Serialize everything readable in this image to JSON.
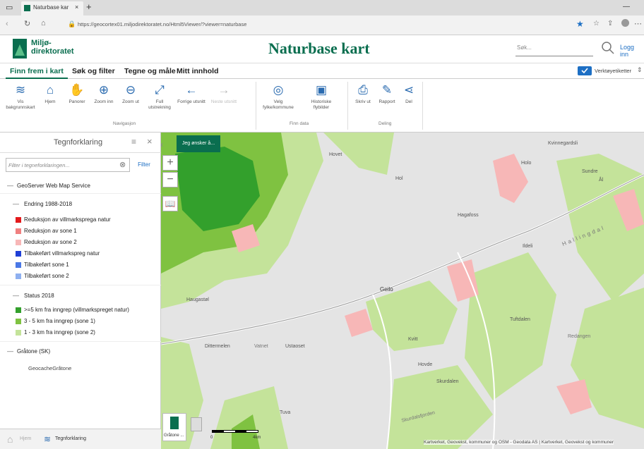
{
  "browser": {
    "tab_title": "Naturbase kar",
    "url": "https://geocortex01.miljodirektoratet.no/Html5Viewer/?viewer=naturbase"
  },
  "header": {
    "logo_line1": "Miljø-",
    "logo_line2": "direktoratet",
    "title": "Naturbase kart",
    "search_placeholder": "Søk...",
    "login": "Logg inn"
  },
  "main_tabs": [
    "Finn frem i kart",
    "Søk og filter",
    "Tegne og måle",
    "Mitt innhold"
  ],
  "toolbar_toggle_label": "Verktøyetiketter",
  "ribbon": {
    "navigation": {
      "label": "Navigasjon",
      "buttons": [
        "Vis bakgrunnskart",
        "Hjem",
        "Panorer",
        "Zoom inn",
        "Zoom ut",
        "Full utstrekning",
        "Forrige utsnitt",
        "Neste utsnitt"
      ]
    },
    "data": {
      "label": "Finn data",
      "buttons": [
        "Velg fylke/kommune",
        "Historiske flybilder"
      ]
    },
    "share": {
      "label": "Deling",
      "buttons": [
        "Skriv ut",
        "Rapport",
        "Del"
      ]
    }
  },
  "panel": {
    "title": "Tegnforklaring",
    "filter_placeholder": "Filter i tegneforklaringen...",
    "filter_button": "Filter",
    "service_title": "GeoServer Web Map Service",
    "groups": [
      {
        "title": "Endring 1988-2018",
        "items": [
          {
            "label": "Reduksjon av villmarksprega natur",
            "color": "#e31a1c"
          },
          {
            "label": "Reduksjon av sone 1",
            "color": "#f08080"
          },
          {
            "label": "Reduksjon av sone 2",
            "color": "#f7b7b7"
          },
          {
            "label": "Tilbakeført villmarkspreg natur",
            "color": "#1f3fd6"
          },
          {
            "label": "Tilbakeført sone 1",
            "color": "#4a78e6"
          },
          {
            "label": "Tilbakeført sone 2",
            "color": "#8fb0f0"
          }
        ]
      },
      {
        "title": "Status 2018",
        "items": [
          {
            "label": ">=5 km fra inngrep (villmarkspreget natur)",
            "color": "#33a02c"
          },
          {
            "label": "3 - 5 km fra inngrep (sone 1)",
            "color": "#7fc241"
          },
          {
            "label": "1 - 3 km fra inngrep (sone 2)",
            "color": "#c4e39a"
          }
        ]
      },
      {
        "title": "Gråtone (SK)",
        "items": [
          {
            "label": "GeocacheGråtone",
            "color": ""
          }
        ]
      }
    ],
    "bottom_tabs": [
      "Hjem",
      "Tegnforklaring"
    ]
  },
  "map": {
    "layer_button": "Jeg ønsker å...",
    "basemap_label": "Gråtone ...",
    "scale": {
      "start": "0",
      "end": "4km"
    },
    "attribution": "Kartverket, Geovekst, kommuner og OSM - Geodata AS | Kartverket, Geovekst og kommuner",
    "places": [
      "Hovet",
      "Hol",
      "Holo",
      "Sundre",
      "Ål",
      "Hagafoss",
      "Ildeli",
      "Hallingdal",
      "Geilo",
      "Haugastøl",
      "Vatnet",
      "Ustaoset",
      "Dittermelen",
      "Kvitt",
      "Hovde",
      "Skurdalen",
      "Tuva",
      "Redangen",
      "Tuftdalen",
      "Kvinnegardsli",
      "Skurdalsfjorden"
    ]
  },
  "colors": {
    "brand": "#0a6e4f",
    "accent": "#1d6fc4"
  }
}
